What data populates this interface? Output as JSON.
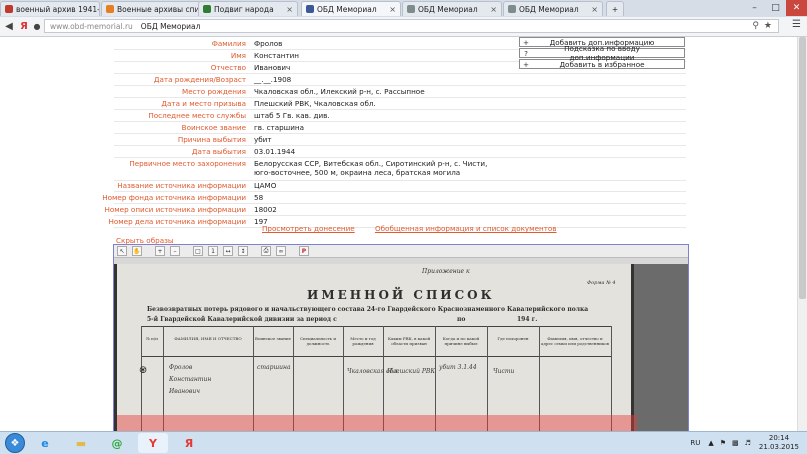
{
  "browser": {
    "tabs": [
      {
        "label": "военный архив 1941-",
        "active": false,
        "color": "#c0392b"
      },
      {
        "label": "Военные архивы спи",
        "active": false,
        "color": "#e67e22"
      },
      {
        "label": "Подвиг народа",
        "active": false,
        "color": "#2e7d32"
      },
      {
        "label": "ОБД Мемориал",
        "active": true,
        "color": "#3b5998"
      },
      {
        "label": "ОБД Мемориал",
        "active": false,
        "color": "#7f8c8d"
      },
      {
        "label": "ОБД Мемориал",
        "active": false,
        "color": "#7f8c8d"
      }
    ],
    "tab_close": "×",
    "new_tab": "+",
    "url": "www.obd-memorial.ru",
    "page_title": "ОБД Мемориал",
    "yandex_letter": "Я",
    "window_controls": {
      "minimize": "–",
      "maximize": "□",
      "close": "✕"
    }
  },
  "person": [
    {
      "label": "Фамилия",
      "value": "Фролов"
    },
    {
      "label": "Имя",
      "value": "Константин"
    },
    {
      "label": "Отчество",
      "value": "Иванович"
    },
    {
      "label": "Дата рождения/Возраст",
      "value": "__.__.1908"
    },
    {
      "label": "Место рождения",
      "value": "Чкаловская обл., Илекский р-н, с. Рассыпное"
    },
    {
      "label": "Дата и место призыва",
      "value": "Плешский РВК, Чкаловская обл."
    },
    {
      "label": "Последнее место службы",
      "value": "штаб 5 Гв. кав. див."
    },
    {
      "label": "Воинское звание",
      "value": "гв. старшина"
    },
    {
      "label": "Причина выбытия",
      "value": "убит"
    },
    {
      "label": "Дата выбытия",
      "value": "03.01.1944"
    },
    {
      "label": "Первичное место захоронения",
      "value": "Белорусская ССР, Витебская обл., Сиротинский р-н, с. Чисти, юго-восточнее, 500 м, окраина леса, братская могила"
    },
    {
      "label": "Название источника информации",
      "value": "ЦАМО"
    },
    {
      "label": "Номер фонда источника информации",
      "value": "58"
    },
    {
      "label": "Номер описи источника информации",
      "value": "18002"
    },
    {
      "label": "Номер дела источника информации",
      "value": "197"
    }
  ],
  "side_buttons": [
    {
      "symbol": "+",
      "label": "Добавить доп.информацию"
    },
    {
      "symbol": "?",
      "label": "Подсказка по вводу доп.информации"
    },
    {
      "symbol": "+",
      "label": "Добавить в избранное"
    }
  ],
  "links": {
    "view_report": "Просмотреть донесение",
    "general_info": "Обобщенная информация и список документов",
    "hide_images": "Скрыть образы"
  },
  "document": {
    "appendix": "Приложение к",
    "form_no": "Форма № 4",
    "title": "ИМЕННОЙ СПИСОК",
    "subtitle_1": "Безвозвратных потерь рядового и начальствующего состава 24-го Гвардейского Краснознаменного Кавалерийского полка",
    "subtitle_2": "5-й Гвардейской Кавалерийской дивизии за период с",
    "period_to": "по",
    "year": "194  г.",
    "columns": [
      "№ п/п",
      "ФАМИЛИЯ, ИМЯ И ОТЧЕСТВО",
      "Воинское звание",
      "Специальность и должность",
      "Место и год рождения",
      "Каким РВК, в какой области призван",
      "Когда и по какой причине выбыл",
      "Где похоронен",
      "Фамилия, имя, отчество и адрес семьи или родственников"
    ],
    "handwriting": [
      "Фролов",
      "Константин",
      "Иванович",
      "старшина",
      "Чкаловская обл.",
      "Плешский РВК",
      "убит 3.1.44",
      "Чисти"
    ]
  },
  "taskbar": {
    "lang": "RU",
    "time": "20:14",
    "date": "21.03.2015",
    "apps": [
      {
        "icon": "ie-icon",
        "glyph": "e",
        "color": "#1e88e5"
      },
      {
        "icon": "folder-icon",
        "glyph": "▬",
        "color": "#e5b84c"
      },
      {
        "icon": "mail-agent-icon",
        "glyph": "@",
        "color": "#2eaa3a"
      },
      {
        "icon": "yandex-browser-icon",
        "glyph": "Y",
        "color": "#e53935"
      },
      {
        "icon": "yandex-icon",
        "glyph": "Я",
        "color": "#e53935"
      }
    ]
  }
}
